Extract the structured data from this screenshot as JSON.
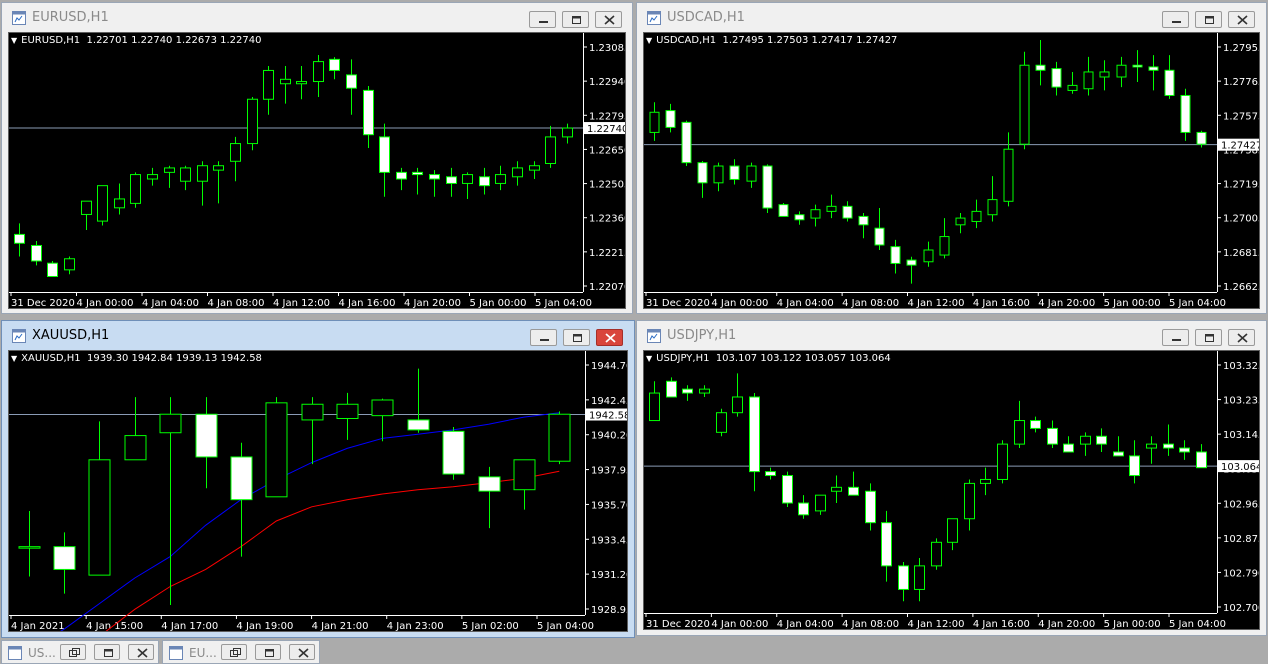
{
  "windows": [
    {
      "id": "eurusd",
      "title": "EURUSD,H1",
      "header_symbol": "EURUSD,H1",
      "header_values": "1.22701 1.22740 1.22673 1.22740",
      "active": false,
      "price_ticks": [
        "1.23085",
        "1.22940",
        "1.22795",
        "1.22650",
        "1.22505",
        "1.22360",
        "1.22215",
        "1.22070"
      ],
      "current_price": "1.22740",
      "time_ticks": [
        "31 Dec 2020",
        "4 Jan 00:00",
        "4 Jan 04:00",
        "4 Jan 08:00",
        "4 Jan 12:00",
        "4 Jan 16:00",
        "4 Jan 20:00",
        "5 Jan 00:00",
        "5 Jan 04:00"
      ]
    },
    {
      "id": "usdcad",
      "title": "USDCAD,H1",
      "header_symbol": "USDCAD,H1",
      "header_values": "1.27495 1.27503 1.27417 1.27427",
      "active": false,
      "price_ticks": [
        "1.27955",
        "1.27765",
        "1.27575",
        "1.27385",
        "1.27195",
        "1.27005",
        "1.26815",
        "1.26625"
      ],
      "current_price": "1.27427",
      "time_ticks": [
        "31 Dec 2020",
        "4 Jan 00:00",
        "4 Jan 04:00",
        "4 Jan 08:00",
        "4 Jan 12:00",
        "4 Jan 16:00",
        "4 Jan 20:00",
        "5 Jan 00:00",
        "5 Jan 04:00"
      ]
    },
    {
      "id": "xauusd",
      "title": "XAUUSD,H1",
      "header_symbol": "XAUUSD,H1",
      "header_values": "1939.30 1942.84 1939.13 1942.58",
      "active": true,
      "price_ticks": [
        "1944.70",
        "1942.45",
        "1940.20",
        "1937.95",
        "1935.70",
        "1933.45",
        "1931.20",
        "1928.95"
      ],
      "current_price": "1942.58",
      "time_ticks": [
        "4 Jan 2021",
        "4 Jan 15:00",
        "4 Jan 17:00",
        "4 Jan 19:00",
        "4 Jan 21:00",
        "4 Jan 23:00",
        "5 Jan 02:00",
        "5 Jan 04:00"
      ]
    },
    {
      "id": "usdjpy",
      "title": "USDJPY,H1",
      "header_symbol": "USDJPY,H1",
      "header_values": "103.107 103.122 103.057 103.064",
      "active": false,
      "price_ticks": [
        "103.325",
        "103.235",
        "103.145",
        "103.055",
        "102.965",
        "102.875",
        "102.790",
        "102.700"
      ],
      "current_price": "103.064",
      "time_ticks": [
        "31 Dec 2020",
        "4 Jan 00:00",
        "4 Jan 04:00",
        "4 Jan 08:00",
        "4 Jan 12:00",
        "4 Jan 16:00",
        "4 Jan 20:00",
        "5 Jan 00:00",
        "5 Jan 04:00"
      ]
    }
  ],
  "minimized": [
    {
      "title": "US..."
    },
    {
      "title": "EU..."
    }
  ],
  "chart_data": [
    {
      "type": "candlestick",
      "symbol": "EURUSD,H1",
      "ylim": [
        1.22,
        1.2316
      ],
      "current": 1.2274,
      "x": [
        "31 Dec 2020",
        "4 Jan 00:00",
        "4 Jan 04:00",
        "4 Jan 08:00",
        "4 Jan 12:00",
        "4 Jan 16:00",
        "4 Jan 20:00",
        "5 Jan 00:00",
        "5 Jan 04:00"
      ],
      "ohlc": [
        [
          1.2226,
          1.2231,
          1.2216,
          1.2222
        ],
        [
          1.2221,
          1.2223,
          1.2212,
          1.2214
        ],
        [
          1.2213,
          1.2214,
          1.2207,
          1.2207
        ],
        [
          1.221,
          1.2216,
          1.2208,
          1.2215
        ],
        [
          1.2235,
          1.224,
          1.2228,
          1.2241
        ],
        [
          1.2232,
          1.2247,
          1.223,
          1.2248
        ],
        [
          1.2238,
          1.2249,
          1.2235,
          1.2242
        ],
        [
          1.224,
          1.2254,
          1.2238,
          1.2253
        ],
        [
          1.2251,
          1.2256,
          1.2248,
          1.2253
        ],
        [
          1.2254,
          1.2257,
          1.2247,
          1.2256
        ],
        [
          1.225,
          1.2257,
          1.2246,
          1.2256
        ],
        [
          1.225,
          1.2259,
          1.2239,
          1.2257
        ],
        [
          1.2255,
          1.2259,
          1.224,
          1.2257
        ],
        [
          1.2259,
          1.227,
          1.225,
          1.2267
        ],
        [
          1.2267,
          1.2288,
          1.2264,
          1.2287
        ],
        [
          1.2287,
          1.2302,
          1.228,
          1.23
        ],
        [
          1.2294,
          1.2302,
          1.2285,
          1.2296
        ],
        [
          1.2294,
          1.2302,
          1.2287,
          1.2295
        ],
        [
          1.2295,
          1.2307,
          1.2288,
          1.2304
        ],
        [
          1.2305,
          1.2306,
          1.2296,
          1.23
        ],
        [
          1.2298,
          1.2305,
          1.228,
          1.2292
        ],
        [
          1.2291,
          1.2293,
          1.2265,
          1.2271
        ],
        [
          1.227,
          1.2276,
          1.2243,
          1.2254
        ],
        [
          1.2254,
          1.2256,
          1.2246,
          1.2251
        ],
        [
          1.2254,
          1.2256,
          1.2244,
          1.2253
        ],
        [
          1.2253,
          1.2255,
          1.2243,
          1.2251
        ],
        [
          1.2252,
          1.2256,
          1.2243,
          1.2249
        ],
        [
          1.2249,
          1.2254,
          1.2242,
          1.2253
        ],
        [
          1.2252,
          1.2256,
          1.2244,
          1.2248
        ],
        [
          1.2249,
          1.2257,
          1.2246,
          1.2253
        ],
        [
          1.2252,
          1.2259,
          1.2248,
          1.2256
        ],
        [
          1.2255,
          1.2259,
          1.2251,
          1.2257
        ],
        [
          1.2258,
          1.2275,
          1.2256,
          1.227
        ],
        [
          1.227,
          1.2276,
          1.2267,
          1.2274
        ]
      ]
    },
    {
      "type": "candlestick",
      "symbol": "USDCAD,H1",
      "ylim": [
        1.2655,
        1.2808
      ],
      "current": 1.27427,
      "x": [
        "31 Dec 2020",
        "4 Jan 00:00",
        "4 Jan 04:00",
        "4 Jan 08:00",
        "4 Jan 12:00",
        "4 Jan 16:00",
        "4 Jan 20:00",
        "5 Jan 00:00",
        "5 Jan 04:00"
      ],
      "ohlc": [
        [
          1.275,
          1.2768,
          1.2745,
          1.2762
        ],
        [
          1.2763,
          1.2767,
          1.275,
          1.2753
        ],
        [
          1.2756,
          1.2757,
          1.273,
          1.2732
        ],
        [
          1.2732,
          1.2733,
          1.2711,
          1.272
        ],
        [
          1.272,
          1.2732,
          1.2715,
          1.273
        ],
        [
          1.273,
          1.2734,
          1.2719,
          1.2722
        ],
        [
          1.2721,
          1.2732,
          1.2717,
          1.273
        ],
        [
          1.273,
          1.2731,
          1.2702,
          1.2705
        ],
        [
          1.2707,
          1.2708,
          1.27,
          1.27
        ],
        [
          1.2701,
          1.2703,
          1.2695,
          1.2698
        ],
        [
          1.2699,
          1.2707,
          1.2694,
          1.2704
        ],
        [
          1.2703,
          1.2713,
          1.2699,
          1.2706
        ],
        [
          1.2706,
          1.2709,
          1.2697,
          1.2699
        ],
        [
          1.27,
          1.2702,
          1.2687,
          1.2695
        ],
        [
          1.2693,
          1.2705,
          1.268,
          1.2683
        ],
        [
          1.2682,
          1.2686,
          1.2666,
          1.2672
        ],
        [
          1.2674,
          1.2676,
          1.266,
          1.2671
        ],
        [
          1.2673,
          1.2685,
          1.267,
          1.268
        ],
        [
          1.2677,
          1.2699,
          1.2675,
          1.2688
        ],
        [
          1.2695,
          1.2702,
          1.269,
          1.2699
        ],
        [
          1.2697,
          1.271,
          1.2693,
          1.2703
        ],
        [
          1.2701,
          1.2724,
          1.2697,
          1.271
        ],
        [
          1.2709,
          1.275,
          1.2706,
          1.274
        ],
        [
          1.2743,
          1.2798,
          1.274,
          1.279
        ],
        [
          1.279,
          1.2805,
          1.2778,
          1.2787
        ],
        [
          1.2788,
          1.2792,
          1.2772,
          1.2777
        ],
        [
          1.2775,
          1.2786,
          1.2773,
          1.2778
        ],
        [
          1.2776,
          1.2795,
          1.2772,
          1.2786
        ],
        [
          1.2783,
          1.2793,
          1.2775,
          1.2786
        ],
        [
          1.2783,
          1.2795,
          1.2777,
          1.279
        ],
        [
          1.279,
          1.2799,
          1.278,
          1.2789
        ],
        [
          1.2789,
          1.2796,
          1.2775,
          1.2787
        ],
        [
          1.2787,
          1.2796,
          1.277,
          1.2772
        ],
        [
          1.2772,
          1.2776,
          1.2745,
          1.275
        ],
        [
          1.275,
          1.2751,
          1.2741,
          1.2743
        ]
      ]
    },
    {
      "type": "candlestick",
      "symbol": "XAUUSD,H1",
      "ylim": [
        1928.5,
        1946.9
      ],
      "current": 1942.58,
      "x": [
        "4 Jan 2021",
        "4 Jan 15:00",
        "4 Jan 17:00",
        "4 Jan 19:00",
        "4 Jan 21:00",
        "4 Jan 23:00",
        "5 Jan 02:00",
        "5 Jan 04:00"
      ],
      "ohlc": [
        [
          1933.2,
          1935.8,
          1931.2,
          1933.3
        ],
        [
          1933.3,
          1934.3,
          1930.0,
          1931.7
        ],
        [
          1931.3,
          1942.1,
          1931.3,
          1939.4
        ],
        [
          1939.4,
          1943.8,
          1939.4,
          1941.1
        ],
        [
          1941.3,
          1943.8,
          1929.2,
          1942.6
        ],
        [
          1942.6,
          1943.8,
          1937.4,
          1939.6
        ],
        [
          1939.6,
          1940.6,
          1932.6,
          1936.6
        ],
        [
          1936.8,
          1943.8,
          1936.8,
          1943.4
        ],
        [
          1942.2,
          1943.8,
          1939.1,
          1943.3
        ],
        [
          1942.3,
          1944.1,
          1940.8,
          1943.3
        ],
        [
          1942.5,
          1943.7,
          1940.7,
          1943.6
        ],
        [
          1942.2,
          1945.8,
          1941.3,
          1941.5
        ],
        [
          1941.4,
          1941.7,
          1938.0,
          1938.4
        ],
        [
          1938.2,
          1938.9,
          1934.6,
          1937.2
        ],
        [
          1937.3,
          1939.3,
          1935.9,
          1939.4
        ],
        [
          1939.3,
          1942.8,
          1939.1,
          1942.6
        ]
      ],
      "overlays": [
        {
          "color": "#0000ff",
          "values": [
            1926.0,
            1927.5,
            1929.3,
            1931.1,
            1932.6,
            1934.8,
            1936.6,
            1938.0,
            1939.2,
            1940.2,
            1940.9,
            1941.2,
            1941.5,
            1941.9,
            1942.4,
            1942.7
          ]
        },
        {
          "color": "#ff0000",
          "values": [
            1924.0,
            1925.4,
            1927.0,
            1928.9,
            1930.5,
            1931.7,
            1933.3,
            1935.1,
            1936.1,
            1936.6,
            1937.0,
            1937.3,
            1937.5,
            1937.8,
            1938.1,
            1938.6
          ]
        }
      ]
    },
    {
      "type": "candlestick",
      "symbol": "USDJPY,H1",
      "ylim": [
        102.69,
        103.352
      ],
      "current": 103.064,
      "x": [
        "31 Dec 2020",
        "4 Jan 00:00",
        "4 Jan 04:00",
        "4 Jan 08:00",
        "4 Jan 12:00",
        "4 Jan 16:00",
        "4 Jan 20:00",
        "5 Jan 00:00",
        "5 Jan 04:00"
      ],
      "ohlc": [
        [
          103.18,
          103.28,
          103.18,
          103.25
        ],
        [
          103.28,
          103.29,
          103.24,
          103.24
        ],
        [
          103.26,
          103.27,
          103.23,
          103.25
        ],
        [
          103.25,
          103.27,
          103.24,
          103.26
        ],
        [
          103.15,
          103.21,
          103.14,
          103.2
        ],
        [
          103.2,
          103.3,
          103.19,
          103.24
        ],
        [
          103.24,
          103.25,
          103.0,
          103.05
        ],
        [
          103.05,
          103.06,
          103.03,
          103.04
        ],
        [
          103.04,
          103.05,
          102.96,
          102.97
        ],
        [
          102.97,
          102.99,
          102.93,
          102.94
        ],
        [
          102.95,
          102.99,
          102.94,
          102.99
        ],
        [
          103.0,
          103.04,
          102.97,
          103.01
        ],
        [
          103.01,
          103.05,
          102.99,
          102.99
        ],
        [
          103.0,
          103.02,
          102.9,
          102.92
        ],
        [
          102.92,
          102.95,
          102.77,
          102.81
        ],
        [
          102.81,
          102.82,
          102.72,
          102.75
        ],
        [
          102.75,
          102.83,
          102.72,
          102.81
        ],
        [
          102.81,
          102.88,
          102.8,
          102.87
        ],
        [
          102.87,
          102.93,
          102.85,
          102.93
        ],
        [
          102.93,
          103.03,
          102.9,
          103.02
        ],
        [
          103.02,
          103.06,
          102.99,
          103.03
        ],
        [
          103.03,
          103.13,
          103.02,
          103.12
        ],
        [
          103.12,
          103.23,
          103.11,
          103.18
        ],
        [
          103.18,
          103.19,
          103.15,
          103.16
        ],
        [
          103.16,
          103.18,
          103.11,
          103.12
        ],
        [
          103.12,
          103.14,
          103.1,
          103.1
        ],
        [
          103.12,
          103.15,
          103.09,
          103.14
        ],
        [
          103.14,
          103.16,
          103.1,
          103.12
        ],
        [
          103.1,
          103.14,
          103.09,
          103.09
        ],
        [
          103.09,
          103.13,
          103.02,
          103.04
        ],
        [
          103.11,
          103.14,
          103.07,
          103.12
        ],
        [
          103.12,
          103.17,
          103.09,
          103.11
        ],
        [
          103.11,
          103.13,
          103.08,
          103.1
        ],
        [
          103.1,
          103.12,
          103.06,
          103.06
        ]
      ]
    }
  ]
}
